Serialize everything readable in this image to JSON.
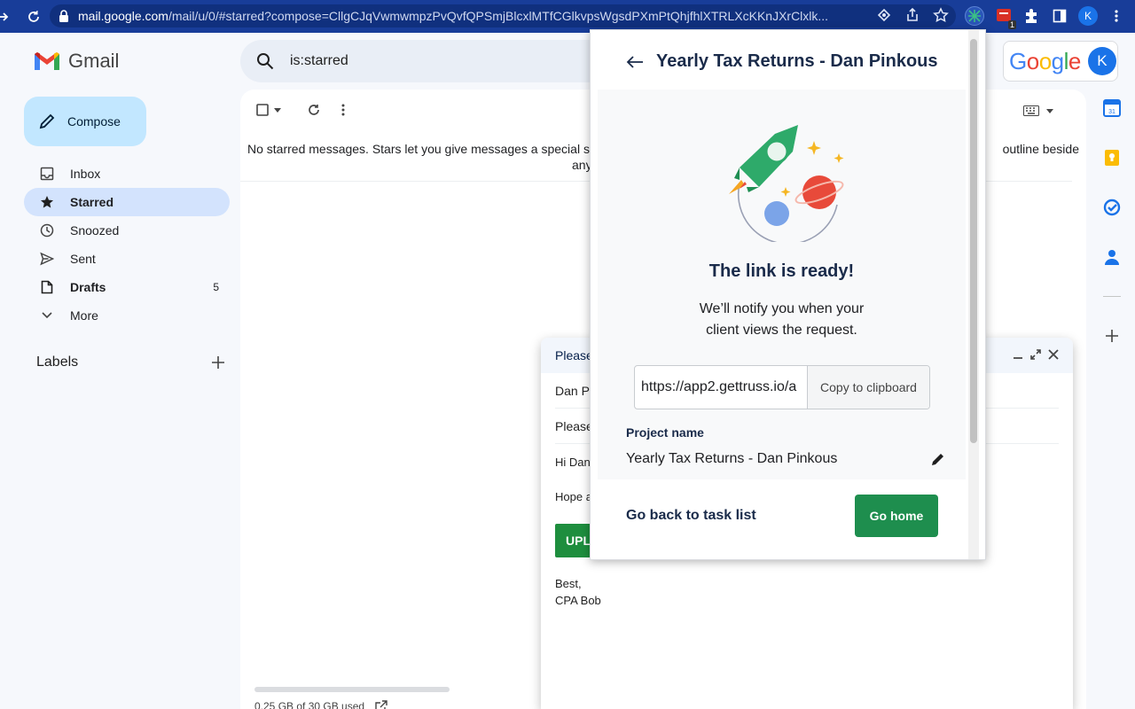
{
  "browser": {
    "url_host": "mail.google.com",
    "url_path": "/mail/u/0/#starred?compose=CllgCJqVwmwmpzPvQvfQPSmjBlcxlMTfCGlkvpsWgsdPXmPtQhjfhlXTRLXcKKnJXrClxlk...",
    "extension_badge": "1",
    "profile_initial": "K"
  },
  "gmail": {
    "app_name": "Gmail",
    "compose_label": "Compose",
    "search_query": "is:starred",
    "nav": [
      {
        "label": "Inbox",
        "icon": "inbox-icon",
        "count": ""
      },
      {
        "label": "Starred",
        "icon": "star-icon",
        "count": "",
        "active": true
      },
      {
        "label": "Snoozed",
        "icon": "clock-icon",
        "count": ""
      },
      {
        "label": "Sent",
        "icon": "send-icon",
        "count": ""
      },
      {
        "label": "Drafts",
        "icon": "draft-icon",
        "count": "5"
      },
      {
        "label": "More",
        "icon": "chevron-down-icon",
        "count": ""
      }
    ],
    "labels_title": "Labels",
    "empty_message_line1": "No starred messages. Stars let you give messages a special s",
    "empty_message_line1_right": "outline beside",
    "empty_message_line2": "any",
    "storage": "0.25 GB of 30 GB used",
    "google_wordmark": "Google",
    "account_initial": "K"
  },
  "compose": {
    "subject": "Please",
    "to": "Dan Pi",
    "subject_field": "Please",
    "greeting": "Hi Dan",
    "body_line": "Hope a",
    "button_label": "UPL",
    "closing": "Best,",
    "signature": "CPA Bob"
  },
  "popup": {
    "title": "Yearly Tax Returns - Dan Pinkous",
    "ready": "The link is ready!",
    "notify_line1": "We’ll notify you when your",
    "notify_line2": "client views the request.",
    "link_value": "https://app2.gettruss.io/a",
    "copy_label": "Copy to clipboard",
    "project_label": "Project name",
    "project_name": "Yearly Tax Returns - Dan Pinkous",
    "back_label": "Go back to task list",
    "home_label": "Go home"
  },
  "colors": {
    "accent_green": "#1e8e4e",
    "compose_bg": "#c2e7ff",
    "active_nav": "#d3e3fd",
    "title_navy": "#1a2b4a"
  }
}
